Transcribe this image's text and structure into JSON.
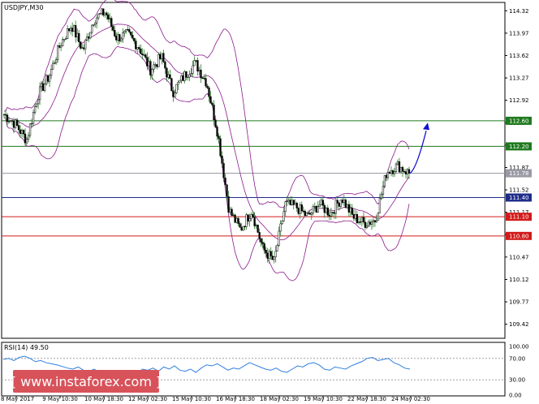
{
  "chart_data": {
    "type": "candlestick",
    "title": "USDJPY,M30",
    "y_axis": {
      "ticks": [
        "114.32",
        "113.97",
        "113.62",
        "113.27",
        "112.92",
        "112.57",
        "112.22",
        "111.87",
        "111.52",
        "111.17",
        "110.82",
        "110.47",
        "110.12",
        "109.77",
        "109.42"
      ],
      "range": [
        109.2,
        114.45
      ]
    },
    "x_axis": {
      "ticks": [
        "8 May 2017",
        "9 May 10:30",
        "10 May 18:30",
        "12 May 02:30",
        "15 May 10:30",
        "16 May 18:30",
        "18 May 02:30",
        "19 May 10:30",
        "22 May 18:30",
        "24 May 02:30"
      ]
    },
    "price_path": [
      112.7,
      112.55,
      112.3,
      113.0,
      113.3,
      113.8,
      114.1,
      113.7,
      114.2,
      114.3,
      113.9,
      113.95,
      113.75,
      113.4,
      113.6,
      113.05,
      113.3,
      113.5,
      113.2,
      112.4,
      111.2,
      110.9,
      111.2,
      110.6,
      110.4,
      111.3,
      111.25,
      111.1,
      111.3,
      111.15,
      111.4,
      111.1,
      111.0,
      111.05,
      111.8,
      111.9,
      111.78
    ],
    "current_price": 111.78,
    "levels": [
      {
        "label": "112.60",
        "value": 112.6,
        "color": "#1f7a1f"
      },
      {
        "label": "112.20",
        "value": 112.2,
        "color": "#1f7a1f"
      },
      {
        "label": "111.78",
        "value": 111.78,
        "color": "#9a9aa6"
      },
      {
        "label": "111.40",
        "value": 111.4,
        "color": "#1f2d8a"
      },
      {
        "label": "111.10",
        "value": 111.1,
        "color": "#d11a1a"
      },
      {
        "label": "110.80",
        "value": 110.8,
        "color": "#d11a1a"
      }
    ],
    "projection": {
      "from": 111.78,
      "to": 112.57,
      "color": "#1010d0"
    },
    "indicator": {
      "label": "RSI(14) 49.50",
      "ticks": [
        "100.00",
        "70.00",
        "30.00",
        "0.00"
      ],
      "levels": [
        70,
        30
      ],
      "values": [
        68,
        70,
        66,
        72,
        74,
        70,
        64,
        66,
        62,
        60,
        58,
        55,
        52,
        50,
        54,
        48,
        46,
        50,
        44,
        40,
        36,
        38,
        34,
        40,
        44,
        42,
        50,
        48,
        52,
        46,
        54,
        50,
        56,
        48,
        46,
        50,
        44,
        52,
        58,
        56,
        60,
        54,
        48,
        52,
        50,
        56,
        62,
        58,
        54,
        50,
        48,
        52,
        46,
        44,
        50,
        56,
        54,
        60,
        62,
        58,
        50,
        48,
        54,
        52,
        50,
        56,
        60,
        64,
        70,
        72,
        66,
        68,
        70,
        62,
        58,
        52,
        50
      ]
    },
    "colors": {
      "candle_up": "#000000",
      "candle_down": "#000000",
      "body_up": "#ffffff",
      "body_down": "#000000",
      "wick": "#2a7a2a",
      "bands": "#8b1a8b",
      "rsi_line": "#2f7fe0",
      "grid": "#c8c8c8"
    }
  },
  "watermark": {
    "text": "[ www.instaforex.com ]",
    "background": "#d8525a"
  }
}
